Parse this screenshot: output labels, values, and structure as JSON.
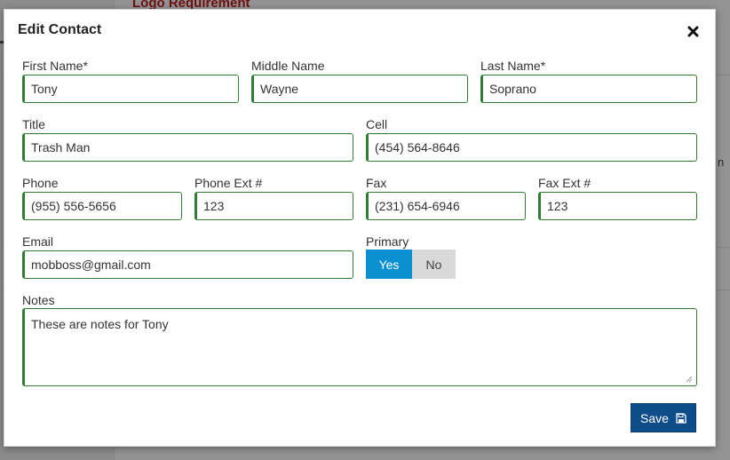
{
  "background": {
    "page_heading": "Logo Requirement",
    "fragment_letter": "n"
  },
  "modal": {
    "title": "Edit Contact",
    "close_icon": "close-x-icon"
  },
  "form": {
    "first_name": {
      "label": "First Name*",
      "value": "Tony"
    },
    "middle_name": {
      "label": "Middle Name",
      "value": "Wayne"
    },
    "last_name": {
      "label": "Last Name*",
      "value": "Soprano"
    },
    "title": {
      "label": "Title",
      "value": "Trash Man"
    },
    "cell": {
      "label": "Cell",
      "value": "(454) 564-8646"
    },
    "phone": {
      "label": "Phone",
      "value": "(955) 556-5656"
    },
    "phone_ext": {
      "label": "Phone Ext #",
      "value": "123"
    },
    "fax": {
      "label": "Fax",
      "value": "(231) 654-6946"
    },
    "fax_ext": {
      "label": "Fax Ext #",
      "value": "123"
    },
    "email": {
      "label": "Email",
      "value": "mobboss@gmail.com"
    },
    "primary": {
      "label": "Primary",
      "yes_label": "Yes",
      "no_label": "No",
      "selected": "Yes"
    },
    "notes": {
      "label": "Notes",
      "value": "These are notes for Tony"
    }
  },
  "actions": {
    "save_label": "Save",
    "save_icon": "floppy-disk-icon"
  },
  "colors": {
    "field_border": "#2e7d32",
    "toggle_active": "#0a8fd0",
    "toggle_inactive": "#d9d9d9",
    "save_button": "#0f4c8a"
  }
}
